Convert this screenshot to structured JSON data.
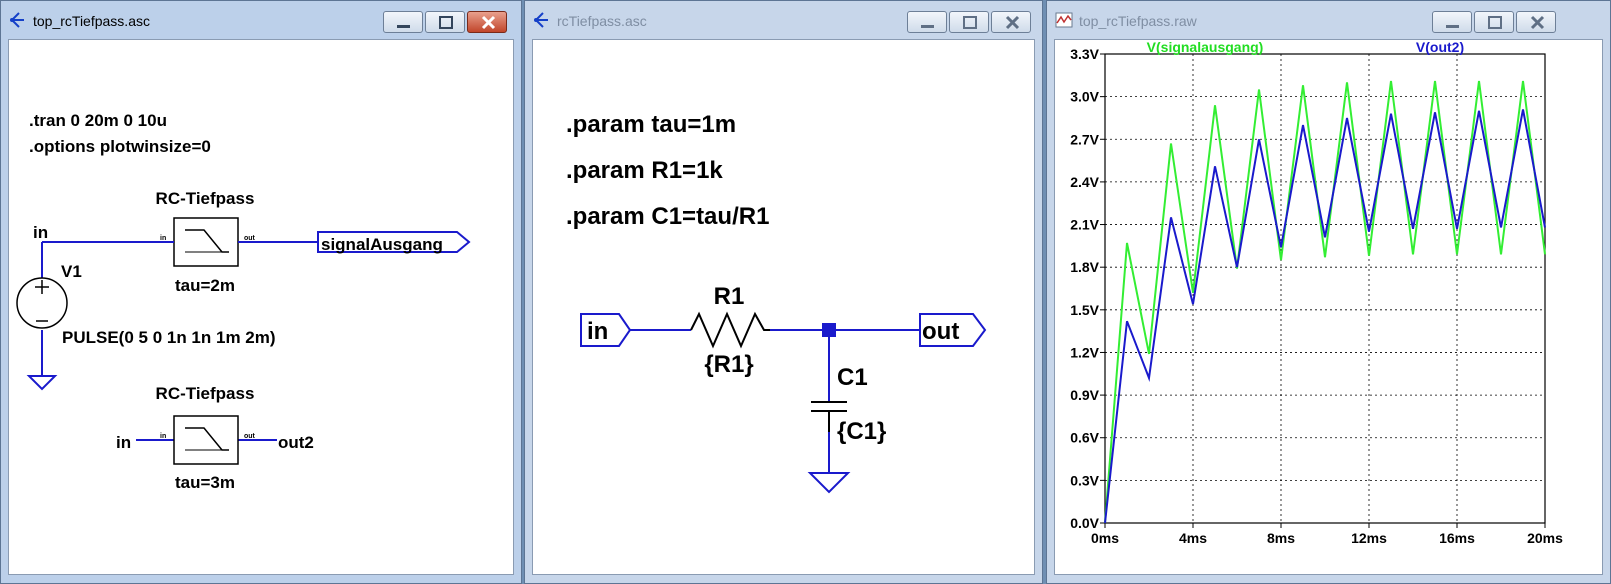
{
  "windows": [
    {
      "title": "top_rcTiefpass.asc",
      "schematic": {
        "directive_tran": ".tran 0 20m 0 10u",
        "directive_options": ".options plotwinsize=0",
        "block1": {
          "name": "RC-Tiefpass",
          "param": "tau=2m",
          "pin_in": "in",
          "pin_out": "out"
        },
        "block2": {
          "name": "RC-Tiefpass",
          "param": "tau=3m",
          "pin_in": "in",
          "pin_out": "out"
        },
        "net_in_label": "in",
        "net_in2_label": "in",
        "out_port_label": "signalAusgang",
        "out2_label": "out2",
        "source_name": "V1",
        "source_value": "PULSE(0 5 0 1n 1n 1m 2m)"
      }
    },
    {
      "title": "rcTiefpass.asc",
      "schematic": {
        "param1": ".param tau=1m",
        "param2": ".param R1=1k",
        "param3": ".param C1=tau/R1",
        "port_in": "in",
        "port_out": "out",
        "resistor_name": "R1",
        "resistor_value": "{R1}",
        "capacitor_name": "C1",
        "capacitor_value": "{C1}"
      }
    },
    {
      "title": "top_rcTiefpass.raw"
    }
  ],
  "chart_data": {
    "type": "line",
    "title": "",
    "xlabel": "",
    "ylabel": "",
    "xlim": [
      0,
      20
    ],
    "ylim": [
      0,
      3.3
    ],
    "x_ticks": [
      "0ms",
      "4ms",
      "8ms",
      "12ms",
      "16ms",
      "20ms"
    ],
    "y_ticks": [
      "0.0V",
      "0.3V",
      "0.6V",
      "0.9V",
      "1.2V",
      "1.5V",
      "1.8V",
      "2.1V",
      "2.4V",
      "2.7V",
      "3.0V",
      "3.3V"
    ],
    "grid": true,
    "series": [
      {
        "name": "V(signalausgang)",
        "color": "#33ee33",
        "x": [
          0,
          1,
          2,
          3,
          4,
          5,
          6,
          7,
          8,
          9,
          10,
          11,
          12,
          13,
          14,
          15,
          16,
          17,
          18,
          19,
          20
        ],
        "y": [
          0,
          1.97,
          1.19,
          2.67,
          1.62,
          2.94,
          1.79,
          3.05,
          1.85,
          3.08,
          1.87,
          3.1,
          1.88,
          3.11,
          1.89,
          3.11,
          1.89,
          3.11,
          1.89,
          3.11,
          1.89
        ]
      },
      {
        "name": "V(out2)",
        "color": "#1a1acc",
        "x": [
          0,
          1,
          2,
          3,
          4,
          5,
          6,
          7,
          8,
          9,
          10,
          11,
          12,
          13,
          14,
          15,
          16,
          17,
          18,
          19,
          20
        ],
        "y": [
          0,
          1.42,
          1.02,
          2.15,
          1.54,
          2.51,
          1.8,
          2.7,
          1.94,
          2.8,
          2.01,
          2.85,
          2.05,
          2.88,
          2.07,
          2.89,
          2.07,
          2.9,
          2.08,
          2.91,
          2.08
        ]
      }
    ]
  }
}
